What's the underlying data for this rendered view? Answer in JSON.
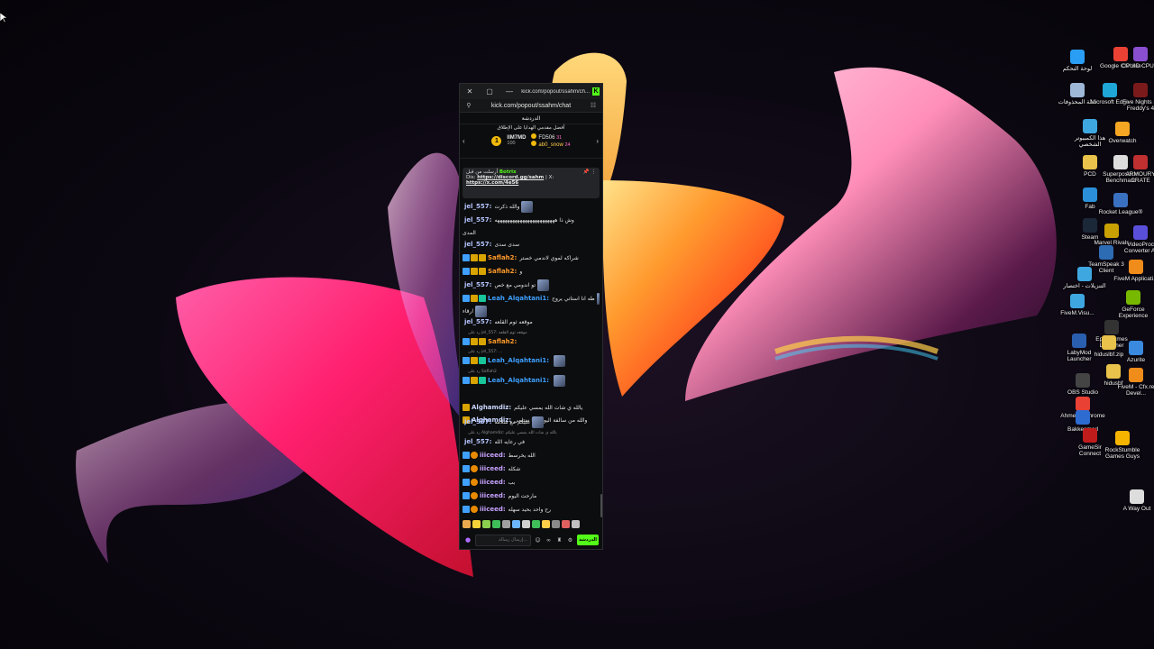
{
  "window": {
    "title_url": "kick.com/popout/ssahm/ch...",
    "address_url": "kick.com/popout/ssahm/chat",
    "chat_header": "الدردشة",
    "leaderboard_title": "أفضل مقدمي الهدايا على الإطلاق",
    "leaders": [
      {
        "name": "IIM7MD",
        "points": "100",
        "extra": ""
      },
      {
        "name": "FD506",
        "points": "31",
        "extra": ""
      },
      {
        "name": "ab0_snow",
        "points": "24",
        "extra": ""
      }
    ],
    "pinned": {
      "pinned_by": "أرسلت من قبل",
      "user": "Botrix",
      "line1_prefix": "Dis:",
      "link1": "https://discord.gg/sahm",
      "sep": "| X:",
      "link2": "https://x.com/4e56"
    },
    "send_label": "الدردشة",
    "input_placeholder": "إرسال رسالة...",
    "brand_color": "#53fc18"
  },
  "messages": [
    {
      "user": "jel_557",
      "text": "والله ذكرت",
      "color": "jel"
    },
    {
      "user": "jel_557",
      "text": "وش ذا ههههههههههههههههههههههههه",
      "color": "jel"
    },
    {
      "user": "",
      "text": "المدى",
      "color": "jel"
    },
    {
      "user": "jel_557",
      "text": "سدى سدى",
      "color": "jel"
    },
    {
      "user": "Saflah2",
      "text": "شراكه لموي لاندمي خصتر",
      "color": "saf"
    },
    {
      "user": "Saflah2",
      "text": "و",
      "color": "saf"
    },
    {
      "user": "jel_557",
      "text": "تو اندومي مع خص",
      "color": "jel"
    },
    {
      "user": "Leah_Alqahtani1",
      "text": "طه انا استاتي يروح",
      "color": "leah"
    },
    {
      "user": "",
      "text": "ارقاء",
      "color": "leah"
    },
    {
      "user": "jel_557",
      "text": "موقعه ثوم القلعه",
      "color": "jel"
    },
    {
      "user": "Saflah2",
      "text": "",
      "color": "saf"
    },
    {
      "user": "Leah_Alqahtani1",
      "text": "",
      "color": "leah"
    },
    {
      "user": "Leah_Alqahtani1",
      "text": "",
      "color": "leah"
    },
    {
      "user": "Alghamdiz",
      "text": "يالله ي شات الله يمسي عليكم",
      "color": "algh"
    },
    {
      "user": "Alghamdiz",
      "text": "والله من سالفة اليوم وانا ستلمى",
      "color": "algh"
    },
    {
      "user": "jel_557",
      "text": "عليكم مع سلامه",
      "color": "jel"
    },
    {
      "user": "jel_557",
      "text": "في رعايه الله",
      "color": "jel"
    },
    {
      "user": "iiiceed",
      "text": "الله يخرسط",
      "color": "iii"
    },
    {
      "user": "iiiceed",
      "text": "شكله",
      "color": "iii"
    },
    {
      "user": "iiiceed",
      "text": "بب",
      "color": "iii"
    },
    {
      "user": "iiiceed",
      "text": "مارحت اليوم",
      "color": "iii"
    },
    {
      "user": "iiiceed",
      "text": "رح واحد بحيد سهله",
      "color": "iii"
    }
  ],
  "replies": [
    {
      "text": "رد على jel_557: موقعه ثوم القلعه"
    },
    {
      "text": "رد على jel_557: ..."
    },
    {
      "text": "رد على Saflah2"
    },
    {
      "text": "رد على Alghamdiz: يالله ي شات الله يمسي عليكم"
    }
  ],
  "desktop_icons": [
    {
      "label": "لوحة التحكم",
      "color": "#2a9df4"
    },
    {
      "label": "Google Chrome",
      "color": "#e94235"
    },
    {
      "label": "CPUID CPU-Z",
      "color": "#8a4fd0"
    },
    {
      "label": "سلة المحذوفات",
      "color": "#9fb8d8"
    },
    {
      "label": "Microsoft Edge",
      "color": "#1fa7d8"
    },
    {
      "label": "Five Nights at Freddy's 4",
      "color": "#7a1a1a"
    },
    {
      "label": "هذا الكمبيوتر الشخصي",
      "color": "#3fa7e0"
    },
    {
      "label": "Overwatch",
      "color": "#f5a623"
    },
    {
      "label": "PCD",
      "color": "#e8c24a"
    },
    {
      "label": "Superposition Benchmark",
      "color": "#dddddd"
    },
    {
      "label": "ARMOURY CRATE",
      "color": "#c03030"
    },
    {
      "label": "Fab",
      "color": "#2b90d9"
    },
    {
      "label": "Rocket League®",
      "color": "#3a70c0"
    },
    {
      "label": "Steam",
      "color": "#1b2838"
    },
    {
      "label": "Marvel Rivals",
      "color": "#c8a000"
    },
    {
      "label": "VideoProc Converter AI",
      "color": "#5a4fd8"
    },
    {
      "label": "التنزيلات - اختصار",
      "color": "#3fa7e0"
    },
    {
      "label": "TeamSpeak 3 Client",
      "color": "#2d6bb3"
    },
    {
      "label": "FiveM Applicati...",
      "color": "#f08c1a"
    },
    {
      "label": "FiveM.Visu...",
      "color": "#3fa7e0"
    },
    {
      "label": "GeForce Experience",
      "color": "#76b900"
    },
    {
      "label": "Epic Games Launcher",
      "color": "#333333"
    },
    {
      "label": "LabyMod Launcher",
      "color": "#2a5fb0"
    },
    {
      "label": "hiduslbf.zip",
      "color": "#e8c24a"
    },
    {
      "label": "Azurite",
      "color": "#3a8ae0"
    },
    {
      "label": "OBS Studio",
      "color": "#444444"
    },
    {
      "label": "hidusbf",
      "color": "#e8c24a"
    },
    {
      "label": "FiveM - Cfx.re Devel...",
      "color": "#f08c1a"
    },
    {
      "label": "Ahmed - Chrome",
      "color": "#e94235"
    },
    {
      "label": "Bakkesmod",
      "color": "#2d6bd0"
    },
    {
      "label": "GameSir Connect",
      "color": "#c01c1c"
    },
    {
      "label": "RockStumble Games Guys",
      "color": "#f5b400"
    },
    {
      "label": "A Way Out",
      "color": "#dddddd"
    }
  ]
}
